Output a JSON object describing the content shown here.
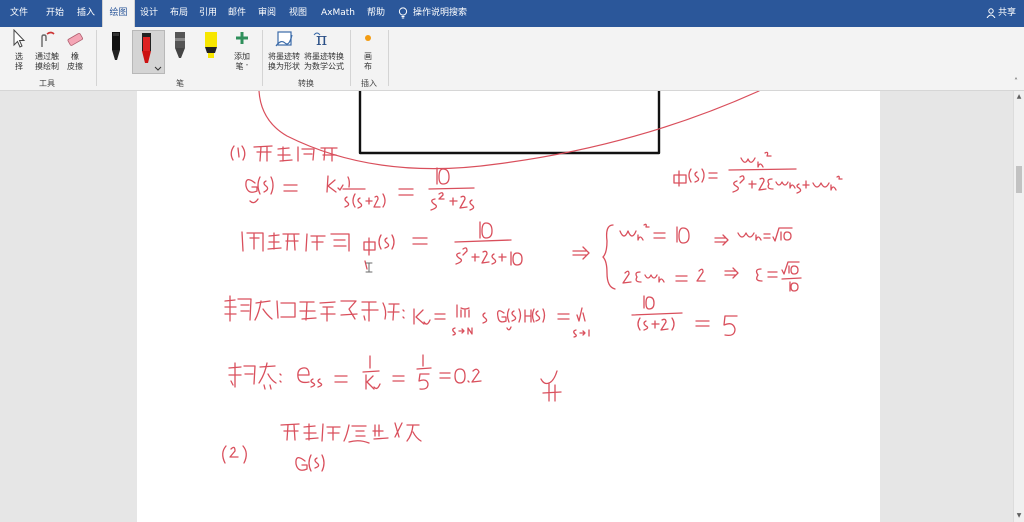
{
  "tabs": [
    {
      "label": "文件"
    },
    {
      "label": "开始"
    },
    {
      "label": "插入"
    },
    {
      "label": "绘图"
    },
    {
      "label": "设计"
    },
    {
      "label": "布局"
    },
    {
      "label": "引用"
    },
    {
      "label": "邮件"
    },
    {
      "label": "审阅"
    },
    {
      "label": "视图"
    },
    {
      "label": "AxMath"
    },
    {
      "label": "帮助"
    }
  ],
  "tell_me": "操作说明搜索",
  "share": "共享",
  "ribbon": {
    "tools": {
      "select_l1": "选",
      "select_l2": "择",
      "draw_touch_l1": "通过触",
      "draw_touch_l2": "摸绘制",
      "eraser_l1": "橡",
      "eraser_l2": "皮擦",
      "group": "工具"
    },
    "pens": {
      "add_pen_l1": "添加",
      "add_pen_l2": "笔",
      "group": "笔"
    },
    "convert": {
      "to_shape_l1": "将墨迹转",
      "to_shape_l2": "换为形状",
      "to_math_l1": "将墨迹转换",
      "to_math_l2": "为数学公式",
      "group": "转换"
    },
    "insert": {
      "canvas_l1": "画",
      "canvas_l2": "布",
      "group": "插入"
    }
  },
  "colors": {
    "tabbar": "#2b579a",
    "ink_red": "#d94f5c",
    "ink_black": "#111111",
    "pen_yellow": "#f7e600"
  },
  "ink_notes": [
    {
      "text": "(1) 开环传函"
    },
    {
      "text": "G(s) = K₀·1/(s(s+2)) = 10/(s²+2s)"
    },
    {
      "text": "Φ(s) = ωn²/(s²+2ξωns+ωn²)"
    },
    {
      "text": "闭环传函 Φ(s) = 10/(s²+2s+10)"
    },
    {
      "text": "ωn² = 10 ⇒ ωn = √10"
    },
    {
      "text": "2ξωn = 2 ⇒ ξ = √10/10"
    },
    {
      "text": "静态误差系数法: Kv = lim s→0 s·G(s)H(s) = lim s→0 10/(s+2) = 5"
    },
    {
      "text": "稳态: ess = 1/Kv = 1/5 = 0.2"
    },
    {
      "text": "(2) 开环传递函数 G(s)"
    }
  ]
}
